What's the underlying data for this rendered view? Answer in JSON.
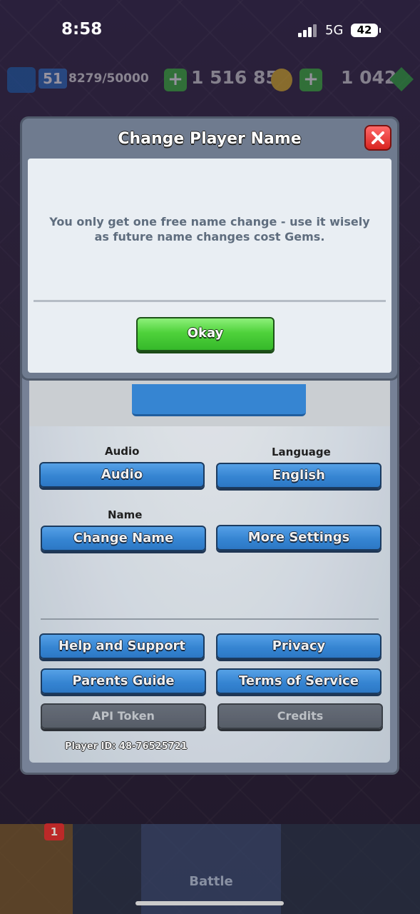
{
  "status_bar": {
    "time": "8:58",
    "network": "5G",
    "battery": "42"
  },
  "hud": {
    "level": "51",
    "xp": "8279/50000",
    "gold": "1 516 851",
    "gems": "1 042"
  },
  "modal": {
    "title": "Change Player Name",
    "message": "You only get one free name change - use it wisely as future name changes cost Gems.",
    "okay_label": "Okay"
  },
  "settings": {
    "audio_section": "Audio",
    "audio_button": "Audio",
    "language_section": "Language",
    "language_button": "English",
    "name_section": "Name",
    "change_name_button": "Change Name",
    "more_settings_button": "More Settings",
    "help_button": "Help and Support",
    "privacy_button": "Privacy",
    "parents_guide_button": "Parents Guide",
    "terms_button": "Terms of Service",
    "api_token_button": "API Token",
    "credits_button": "Credits",
    "player_id": "Player ID: 48-76525721"
  },
  "nav": {
    "shop_badge": "1",
    "battle_label": "Battle"
  },
  "colors": {
    "accent_blue": "#3a8ee0",
    "okay_green": "#4fd23b",
    "close_red": "#d9241f"
  }
}
